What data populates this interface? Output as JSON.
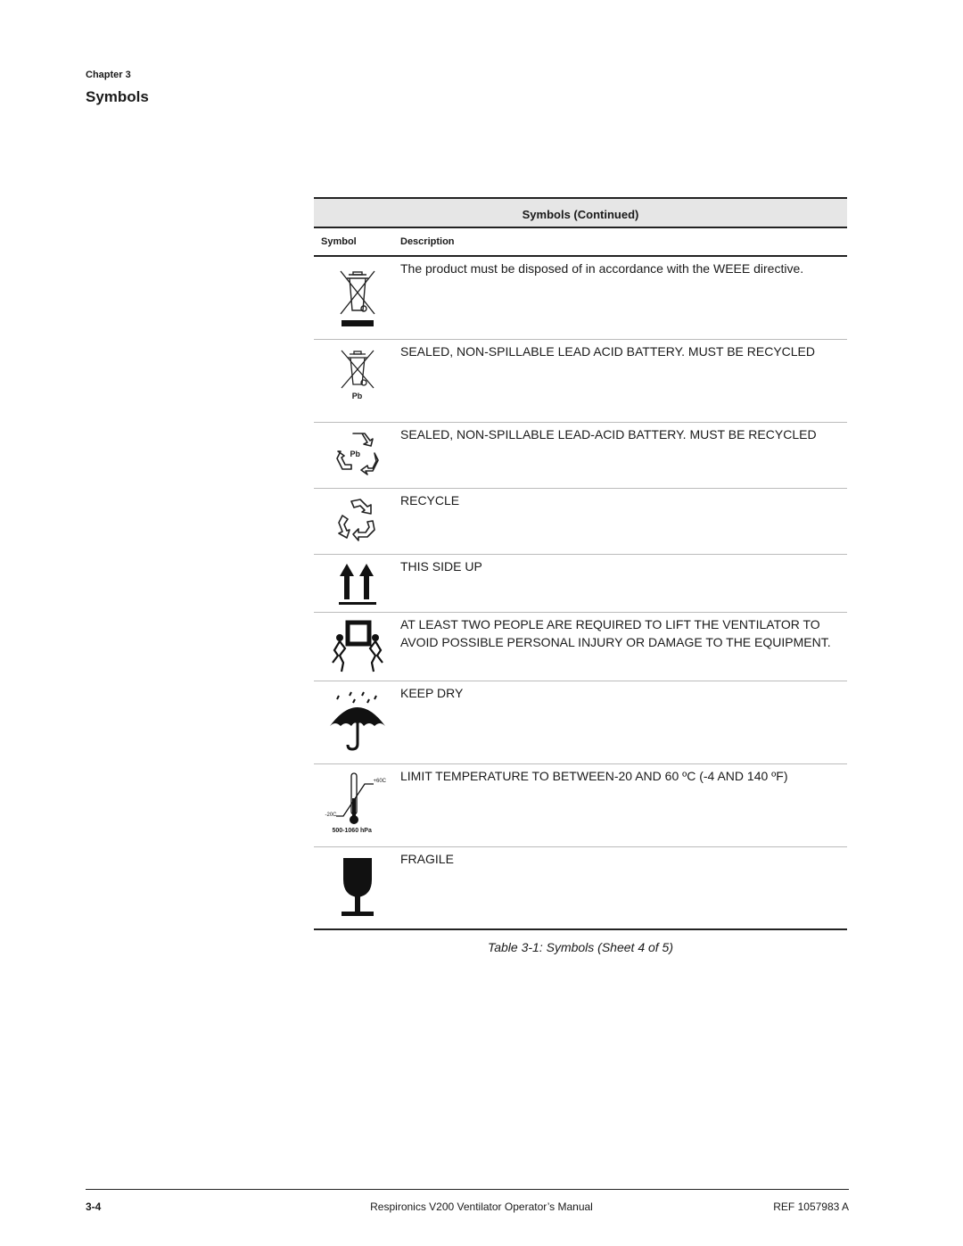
{
  "header": {
    "chapter": "Chapter 3",
    "title": "Symbols"
  },
  "table": {
    "title": "Symbols (Continued)",
    "columns": [
      "Symbol",
      "Description"
    ],
    "rows": [
      {
        "icon": "weee-bin-icon",
        "description": "The product must be disposed of in accordance with the WEEE directive."
      },
      {
        "icon": "weee-bin-pb-icon",
        "icon_label": "Pb",
        "description": "SEALED, NON-SPILLABLE LEAD ACID BATTERY. MUST BE RECYCLED"
      },
      {
        "icon": "recycle-pb-icon",
        "icon_label": "Pb",
        "description": "SEALED, NON-SPILLABLE LEAD-ACID BATTERY. MUST BE RECYCLED"
      },
      {
        "icon": "recycle-icon",
        "description": "RECYCLE"
      },
      {
        "icon": "this-side-up-icon",
        "description": "THIS SIDE UP"
      },
      {
        "icon": "two-person-lift-icon",
        "description": "AT LEAST TWO PEOPLE ARE REQUIRED TO LIFT THE VENTILATOR TO AVOID POSSIBLE PERSONAL INJURY OR DAMAGE TO THE EQUIPMENT."
      },
      {
        "icon": "keep-dry-umbrella-icon",
        "description": "KEEP DRY"
      },
      {
        "icon": "temperature-limit-icon",
        "icon_labels": {
          "high": "+60C",
          "low": "-20C",
          "pressure": "500-1060 hPa"
        },
        "description": "LIMIT TEMPERATURE TO BETWEEN-20 AND 60 ºC (-4 AND 140 ºF)"
      },
      {
        "icon": "fragile-glass-icon",
        "description": "FRAGILE"
      }
    ],
    "caption": "Table 3-1: Symbols (Sheet 4 of 5)"
  },
  "footer": {
    "page": "3-4",
    "manual": "Respironics V200 Ventilator Operator’s Manual",
    "ref": "REF 1057983 A"
  }
}
